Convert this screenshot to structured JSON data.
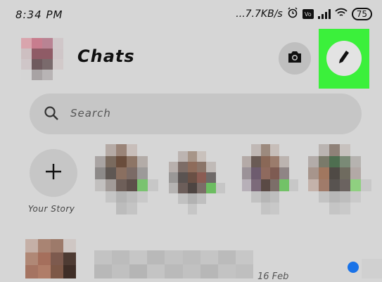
{
  "status_bar": {
    "time": "8:34 PM",
    "speed": "...7.7KB/s",
    "volte": "Vo",
    "battery": "75"
  },
  "header": {
    "title": "Chats",
    "icons": {
      "camera": "camera-icon",
      "edit": "pencil-icon"
    },
    "highlight_color": "#3bf03b"
  },
  "search": {
    "placeholder": "Search"
  },
  "stories": {
    "your_story_label": "Your Story"
  },
  "chat_list": {
    "first_row": {
      "time": "16 Feb",
      "unread_color": "#1a73e8"
    }
  }
}
